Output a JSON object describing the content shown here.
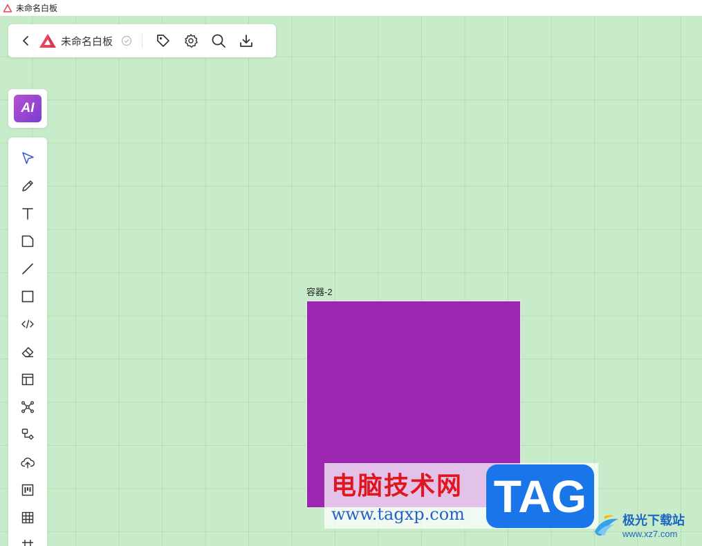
{
  "window": {
    "title": "未命名白板",
    "brand_color": "#e8455a"
  },
  "topbar": {
    "back_icon": "chevron-left-icon",
    "board_title": "未命名白板",
    "saved_icon": "check-circle-icon",
    "actions": [
      {
        "icon": "tag-icon"
      },
      {
        "icon": "gear-icon"
      },
      {
        "icon": "search-icon"
      },
      {
        "icon": "download-icon"
      }
    ]
  },
  "ai": {
    "label": "AI",
    "gradient": [
      "#b84fd1",
      "#7a3fd0"
    ]
  },
  "tools": [
    {
      "icon": "select-arrow-icon",
      "active": true
    },
    {
      "icon": "pencil-icon"
    },
    {
      "icon": "text-icon"
    },
    {
      "icon": "sticky-note-icon"
    },
    {
      "icon": "line-icon"
    },
    {
      "icon": "rectangle-icon"
    },
    {
      "icon": "code-icon"
    },
    {
      "icon": "eraser-icon"
    },
    {
      "icon": "layout-icon"
    },
    {
      "icon": "mindmap-icon"
    },
    {
      "icon": "flowchart-icon"
    },
    {
      "icon": "upload-cloud-icon"
    },
    {
      "icon": "kanban-icon"
    },
    {
      "icon": "table-icon"
    },
    {
      "icon": "grid-frame-icon"
    }
  ],
  "canvas": {
    "background": "#c8ecca",
    "container": {
      "label": "容器-2",
      "fill": "#9b27b0"
    }
  },
  "watermark": {
    "title": "电脑技术网",
    "url": "www.tagxp.com",
    "badge": "TAG",
    "site2_name": "极光下载站",
    "site2_url": "www.xz7.com"
  }
}
